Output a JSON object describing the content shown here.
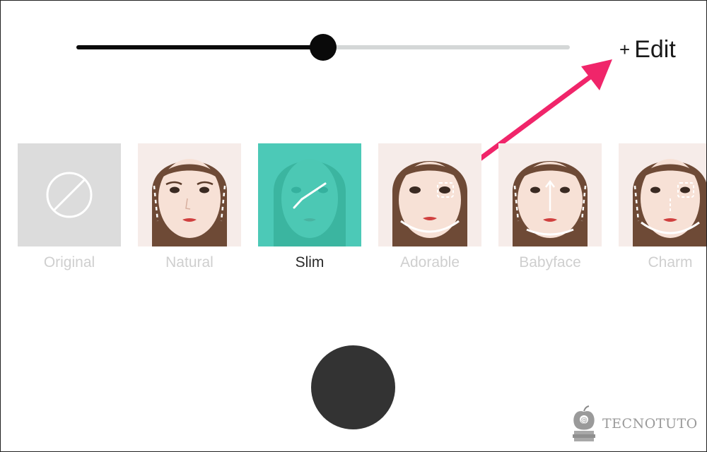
{
  "slider": {
    "value_fraction": 0.5
  },
  "edit": {
    "plus": "+",
    "label": "Edit"
  },
  "filters": [
    {
      "name": "Original",
      "selected": false
    },
    {
      "name": "Natural",
      "selected": false
    },
    {
      "name": "Slim",
      "selected": true
    },
    {
      "name": "Adorable",
      "selected": false
    },
    {
      "name": "Babyface",
      "selected": false
    },
    {
      "name": "Charm",
      "selected": false
    }
  ],
  "watermark": {
    "text": "TECNOTUTO"
  },
  "colors": {
    "accent": "#34C4AF",
    "annotation_arrow": "#F0256A",
    "shutter": "#333333",
    "track": "#D4D7D7",
    "fill": "#0A0A0A"
  },
  "icons": {
    "original": "none-circle-slash-icon",
    "selected": "checkmark-icon",
    "face": "face-preview-icon",
    "watermark": "apple-books-logo-icon"
  }
}
